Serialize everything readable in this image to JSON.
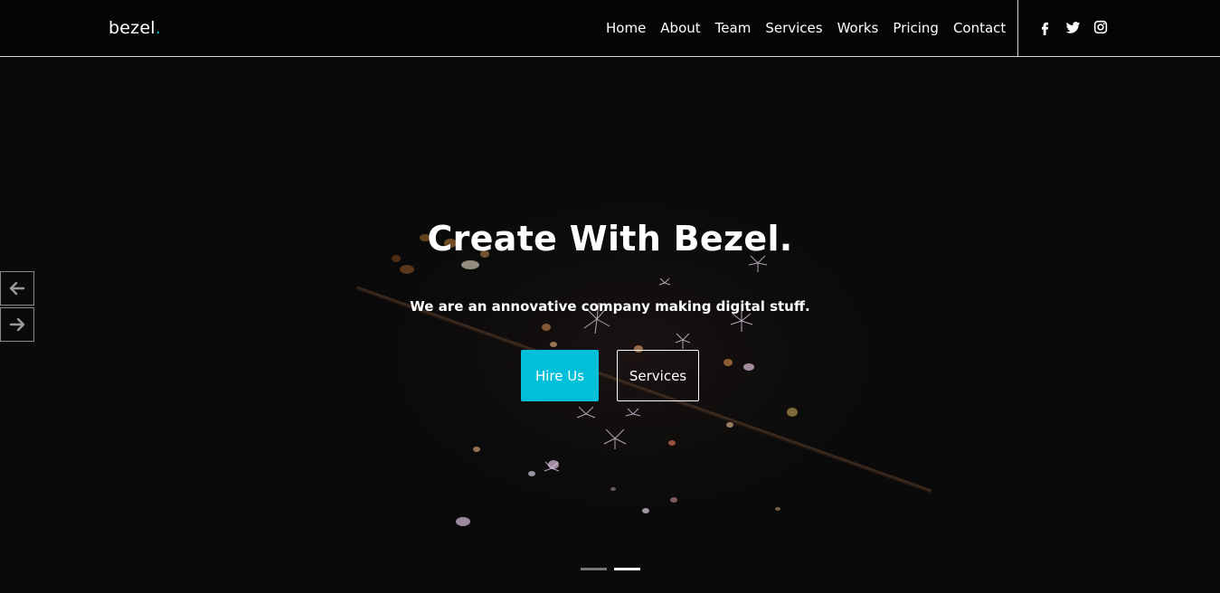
{
  "header": {
    "logo_text": "bezel",
    "logo_dot": ".",
    "nav": [
      {
        "label": "Home"
      },
      {
        "label": "About"
      },
      {
        "label": "Team"
      },
      {
        "label": "Services"
      },
      {
        "label": "Works"
      },
      {
        "label": "Pricing"
      },
      {
        "label": "Contact"
      }
    ],
    "social_icons": [
      "facebook-icon",
      "twitter-icon",
      "instagram-icon"
    ]
  },
  "hero": {
    "title": "Create With Bezel.",
    "subtitle": "We are an annovative company making digital stuff.",
    "primary_button": "Hire Us",
    "secondary_button": "Services",
    "slide_count": 2,
    "active_slide": 2
  },
  "colors": {
    "accent": "#00bfd8",
    "background": "#0a0a0a",
    "header_background": "#050505"
  }
}
